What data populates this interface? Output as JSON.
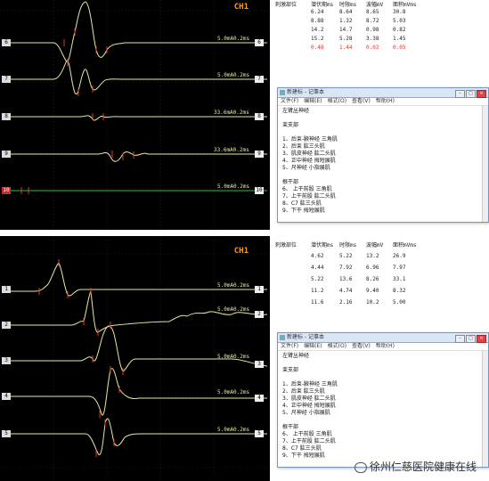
{
  "panels": [
    {
      "channel_label": "CH1",
      "table": {
        "headers": [
          "刺激部位",
          "潜伏期ms",
          "时限ms",
          "波幅mV",
          "面积mVms"
        ],
        "rows": [
          {
            "values": [
              "6.24",
              "8.64",
              "8.65",
              "30.8"
            ],
            "highlight": false
          },
          {
            "values": [
              "8.88",
              "1.32",
              "8.72",
              "5.03"
            ],
            "highlight": false
          },
          {
            "values": [
              "14.2",
              "14.7",
              "0.98",
              "0.82"
            ],
            "highlight": false
          },
          {
            "values": [
              "15.2",
              "5.28",
              "3.38",
              "1.45"
            ],
            "highlight": false
          },
          {
            "values": [
              "0.48",
              "1.44",
              "0.02",
              "0.05"
            ],
            "highlight": true
          }
        ]
      },
      "traces": [
        {
          "id": "6",
          "scale": "5.0mA0.2ms",
          "color": "#e8e8a0"
        },
        {
          "id": "7",
          "scale": "5.0mA0.2ms",
          "color": "#e8e8a0"
        },
        {
          "id": "8",
          "scale": "33.6mA0.2ms",
          "color": "#e8e8a0"
        },
        {
          "id": "9",
          "scale": "33.6mA0.2ms",
          "color": "#e8e8a0"
        },
        {
          "id": "10",
          "scale": "5.0mA0.2ms",
          "color": "#2ec02e"
        }
      ],
      "notepad": {
        "title": "新建标 - 记事本",
        "menu": [
          "文件(F)",
          "编辑(E)",
          "格式(O)",
          "查看(V)",
          "帮助(H)"
        ],
        "lines": [
          "左臂丛神经",
          "",
          "束支部",
          "",
          "1、后束-腋神经    三角肌",
          "2、后束 肱三头肌",
          "3、肌皮神经 肱二头肌",
          "4、正中神经  拇短展肌",
          "5、尺神经   小指展肌",
          "",
          "根干部",
          "6、 上干前股 三角肌",
          "7、上干前股 肱二头肌",
          "8、C7     肱三头肌",
          "9、下干    拇短展肌"
        ]
      }
    },
    {
      "channel_label": "CH1",
      "table": {
        "headers": [
          "刺激部位",
          "潜伏期ms",
          "时限ms",
          "波幅mV",
          "面积mVms"
        ],
        "rows": [
          {
            "values": [
              "4.62",
              "5.22",
              "13.2",
              "26.9"
            ],
            "highlight": false
          },
          {
            "values": [
              "4.44",
              "7.92",
              "6.96",
              "7.97"
            ],
            "highlight": false
          },
          {
            "values": [
              "5.22",
              "13.6",
              "8.26",
              "33.1"
            ],
            "highlight": false
          },
          {
            "values": [
              "11.2",
              "4.74",
              "9.40",
              "8.32"
            ],
            "highlight": false
          },
          {
            "values": [
              "11.6",
              "2.16",
              "10.2",
              "5.00"
            ],
            "highlight": false
          }
        ]
      },
      "traces": [
        {
          "id": "1",
          "scale": "5.0mA0.2ms",
          "color": "#e8e8a0"
        },
        {
          "id": "2",
          "scale": "5.0mA0.2ms",
          "color": "#e8e8a0"
        },
        {
          "id": "3",
          "scale": "5.0mA0.2ms",
          "color": "#e8e8a0"
        },
        {
          "id": "4",
          "scale": "5.0mA0.2ms",
          "color": "#e8e8a0"
        },
        {
          "id": "5",
          "scale": "5.0mA0.2ms",
          "color": "#e8e8a0"
        }
      ],
      "notepad": {
        "title": "新建标 - 记事本",
        "menu": [
          "文件(F)",
          "编辑(E)",
          "格式(O)",
          "查看(V)",
          "帮助(H)"
        ],
        "lines": [
          "左臂丛神经",
          "",
          "束支部",
          "",
          "1、后束-腋神经    三角肌",
          "2、后束 肱三头肌",
          "3、肌皮神经 肱二头肌",
          "4、正中神经  拇短展肌",
          "5、尺神经   小指展肌",
          "",
          "根干部",
          "6、 上干前股 三角肌",
          "7、上干前股 肱二头肌",
          "8、C7     肱三头肌",
          "9、下干    拇短展肌"
        ]
      }
    }
  ],
  "watermark": "徐州仁慈医院健康在线",
  "colors": {
    "screen": "#000000",
    "trace": "#e8e8a0",
    "green_trace": "#2ec02e",
    "marker": "#e03a2a",
    "channel_label": "#ff9a1a",
    "highlight_row": "#e33333"
  }
}
